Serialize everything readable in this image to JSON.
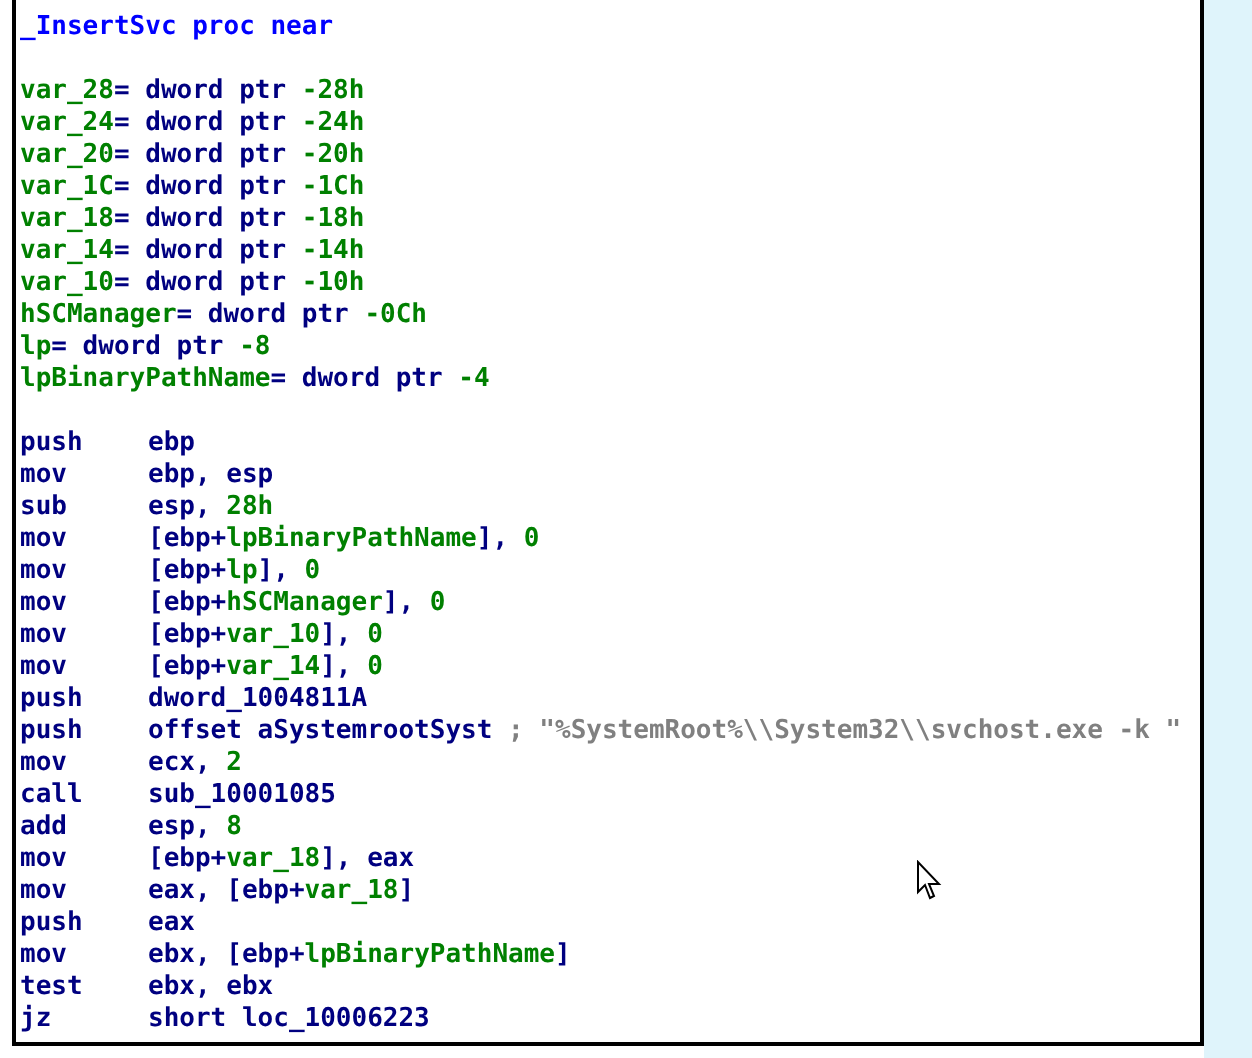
{
  "header": [
    {
      "text": "_InsertSvc proc near",
      "kind": "proc"
    }
  ],
  "declarations": [
    {
      "parts": [
        {
          "text": "var_28",
          "kind": "name"
        },
        {
          "text": "= dword ptr ",
          "kind": "plain"
        },
        {
          "text": "-28h",
          "kind": "number"
        }
      ]
    },
    {
      "parts": [
        {
          "text": "var_24",
          "kind": "name"
        },
        {
          "text": "= dword ptr ",
          "kind": "plain"
        },
        {
          "text": "-24h",
          "kind": "number"
        }
      ]
    },
    {
      "parts": [
        {
          "text": "var_20",
          "kind": "name"
        },
        {
          "text": "= dword ptr ",
          "kind": "plain"
        },
        {
          "text": "-20h",
          "kind": "number"
        }
      ]
    },
    {
      "parts": [
        {
          "text": "var_1C",
          "kind": "name"
        },
        {
          "text": "= dword ptr ",
          "kind": "plain"
        },
        {
          "text": "-1Ch",
          "kind": "number"
        }
      ]
    },
    {
      "parts": [
        {
          "text": "var_18",
          "kind": "name"
        },
        {
          "text": "= dword ptr ",
          "kind": "plain"
        },
        {
          "text": "-18h",
          "kind": "number"
        }
      ]
    },
    {
      "parts": [
        {
          "text": "var_14",
          "kind": "name"
        },
        {
          "text": "= dword ptr ",
          "kind": "plain"
        },
        {
          "text": "-14h",
          "kind": "number"
        }
      ]
    },
    {
      "parts": [
        {
          "text": "var_10",
          "kind": "name"
        },
        {
          "text": "= dword ptr ",
          "kind": "plain"
        },
        {
          "text": "-10h",
          "kind": "number"
        }
      ]
    },
    {
      "parts": [
        {
          "text": "hSCManager",
          "kind": "name"
        },
        {
          "text": "= dword ptr ",
          "kind": "plain"
        },
        {
          "text": "-0Ch",
          "kind": "number"
        }
      ]
    },
    {
      "parts": [
        {
          "text": "lp",
          "kind": "name"
        },
        {
          "text": "= dword ptr ",
          "kind": "plain"
        },
        {
          "text": "-8",
          "kind": "number"
        }
      ]
    },
    {
      "parts": [
        {
          "text": "lpBinaryPathName",
          "kind": "name"
        },
        {
          "text": "= dword ptr ",
          "kind": "plain"
        },
        {
          "text": "-4",
          "kind": "number"
        }
      ]
    }
  ],
  "instructions": [
    {
      "mnemonic": "push",
      "operands": [
        {
          "text": "ebp",
          "kind": "plain"
        }
      ]
    },
    {
      "mnemonic": "mov",
      "operands": [
        {
          "text": "ebp, esp",
          "kind": "plain"
        }
      ]
    },
    {
      "mnemonic": "sub",
      "operands": [
        {
          "text": "esp, ",
          "kind": "plain"
        },
        {
          "text": "28h",
          "kind": "number"
        }
      ]
    },
    {
      "mnemonic": "mov",
      "operands": [
        {
          "text": "[ebp+",
          "kind": "plain"
        },
        {
          "text": "lpBinaryPathName",
          "kind": "name"
        },
        {
          "text": "], ",
          "kind": "plain"
        },
        {
          "text": "0",
          "kind": "number"
        }
      ]
    },
    {
      "mnemonic": "mov",
      "operands": [
        {
          "text": "[ebp+",
          "kind": "plain"
        },
        {
          "text": "lp",
          "kind": "name"
        },
        {
          "text": "], ",
          "kind": "plain"
        },
        {
          "text": "0",
          "kind": "number"
        }
      ]
    },
    {
      "mnemonic": "mov",
      "operands": [
        {
          "text": "[ebp+",
          "kind": "plain"
        },
        {
          "text": "hSCManager",
          "kind": "name"
        },
        {
          "text": "], ",
          "kind": "plain"
        },
        {
          "text": "0",
          "kind": "number"
        }
      ]
    },
    {
      "mnemonic": "mov",
      "operands": [
        {
          "text": "[ebp+",
          "kind": "plain"
        },
        {
          "text": "var_10",
          "kind": "name"
        },
        {
          "text": "], ",
          "kind": "plain"
        },
        {
          "text": "0",
          "kind": "number"
        }
      ]
    },
    {
      "mnemonic": "mov",
      "operands": [
        {
          "text": "[ebp+",
          "kind": "plain"
        },
        {
          "text": "var_14",
          "kind": "name"
        },
        {
          "text": "], ",
          "kind": "plain"
        },
        {
          "text": "0",
          "kind": "number"
        }
      ]
    },
    {
      "mnemonic": "push",
      "operands": [
        {
          "text": "dword_1004811A",
          "kind": "plain"
        }
      ]
    },
    {
      "mnemonic": "push",
      "operands": [
        {
          "text": "offset aSystemrootSyst ",
          "kind": "plain"
        },
        {
          "text": "; \"%SystemRoot%\\\\System32\\\\svchost.exe -k \"",
          "kind": "comment"
        }
      ]
    },
    {
      "mnemonic": "mov",
      "operands": [
        {
          "text": "ecx, ",
          "kind": "plain"
        },
        {
          "text": "2",
          "kind": "number"
        }
      ]
    },
    {
      "mnemonic": "call",
      "operands": [
        {
          "text": "sub_10001085",
          "kind": "plain"
        }
      ]
    },
    {
      "mnemonic": "add",
      "operands": [
        {
          "text": "esp, ",
          "kind": "plain"
        },
        {
          "text": "8",
          "kind": "number"
        }
      ]
    },
    {
      "mnemonic": "mov",
      "operands": [
        {
          "text": "[ebp+",
          "kind": "plain"
        },
        {
          "text": "var_18",
          "kind": "name"
        },
        {
          "text": "], eax",
          "kind": "plain"
        }
      ]
    },
    {
      "mnemonic": "mov",
      "operands": [
        {
          "text": "eax, [ebp+",
          "kind": "plain"
        },
        {
          "text": "var_18",
          "kind": "name"
        },
        {
          "text": "]",
          "kind": "plain"
        }
      ]
    },
    {
      "mnemonic": "push",
      "operands": [
        {
          "text": "eax",
          "kind": "plain"
        }
      ]
    },
    {
      "mnemonic": "mov",
      "operands": [
        {
          "text": "ebx, [ebp+",
          "kind": "plain"
        },
        {
          "text": "lpBinaryPathName",
          "kind": "name"
        },
        {
          "text": "]",
          "kind": "plain"
        }
      ]
    },
    {
      "mnemonic": "test",
      "operands": [
        {
          "text": "ebx, ebx",
          "kind": "plain"
        }
      ]
    },
    {
      "mnemonic": "jz",
      "operands": [
        {
          "text": "short loc_10006223",
          "kind": "plain"
        }
      ]
    }
  ]
}
